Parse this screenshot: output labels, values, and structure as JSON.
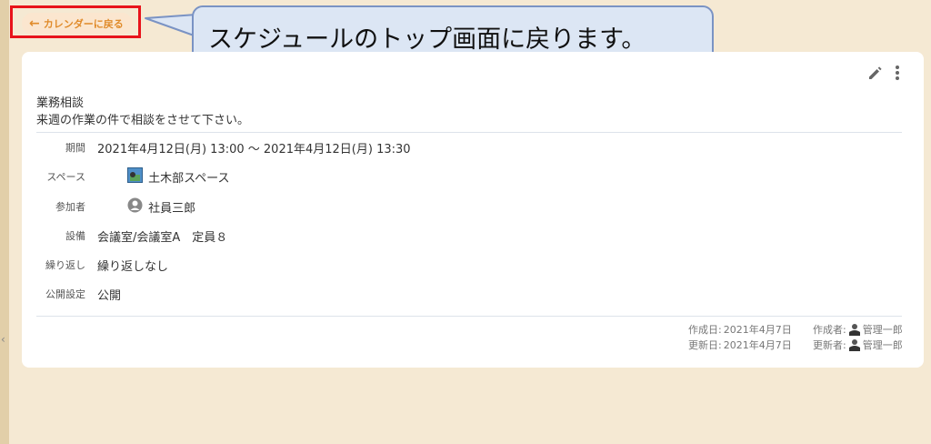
{
  "back_button": {
    "label": "カレンダーに戻る",
    "icon": "arrow-left-icon",
    "color": "#e08b2a"
  },
  "callout": {
    "text": "スケジュールのトップ画面に戻ります。"
  },
  "event": {
    "title": "業務相談",
    "description": "来週の作業の件で相談をさせて下さい。",
    "fields": {
      "period": {
        "label": "期間",
        "value": "2021年4月12日(月) 13:00 ～ 2021年4月12日(月) 13:30"
      },
      "space": {
        "label": "スペース",
        "value": "土木部スペース"
      },
      "participants": {
        "label": "参加者",
        "value": "社員三郎"
      },
      "equipment": {
        "label": "設備",
        "value": "会議室/会議室A　定員８"
      },
      "repeat": {
        "label": "繰り返し",
        "value": "繰り返しなし"
      },
      "visibility": {
        "label": "公開設定",
        "value": "公開"
      }
    },
    "meta": {
      "created_label": "作成日:",
      "created_date": "2021年4月7日",
      "creator_label": "作成者:",
      "creator": "管理一郎",
      "updated_label": "更新日:",
      "updated_date": "2021年4月7日",
      "updater_label": "更新者:",
      "updater": "管理一郎"
    }
  },
  "colors": {
    "background": "#f5e9d3",
    "highlight_border": "#e8131b",
    "callout_fill": "#dce6f4"
  }
}
